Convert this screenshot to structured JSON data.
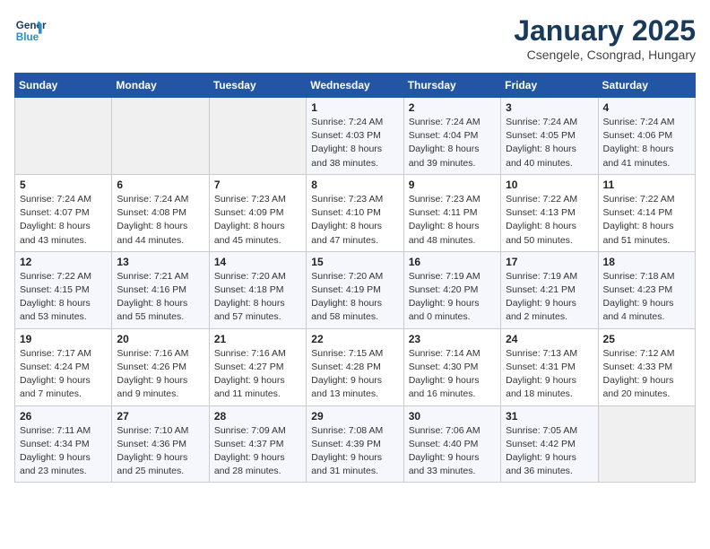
{
  "header": {
    "logo_line1": "General",
    "logo_line2": "Blue",
    "title": "January 2025",
    "subtitle": "Csengele, Csongrad, Hungary"
  },
  "weekdays": [
    "Sunday",
    "Monday",
    "Tuesday",
    "Wednesday",
    "Thursday",
    "Friday",
    "Saturday"
  ],
  "weeks": [
    [
      {
        "day": "",
        "info": ""
      },
      {
        "day": "",
        "info": ""
      },
      {
        "day": "",
        "info": ""
      },
      {
        "day": "1",
        "info": "Sunrise: 7:24 AM\nSunset: 4:03 PM\nDaylight: 8 hours\nand 38 minutes."
      },
      {
        "day": "2",
        "info": "Sunrise: 7:24 AM\nSunset: 4:04 PM\nDaylight: 8 hours\nand 39 minutes."
      },
      {
        "day": "3",
        "info": "Sunrise: 7:24 AM\nSunset: 4:05 PM\nDaylight: 8 hours\nand 40 minutes."
      },
      {
        "day": "4",
        "info": "Sunrise: 7:24 AM\nSunset: 4:06 PM\nDaylight: 8 hours\nand 41 minutes."
      }
    ],
    [
      {
        "day": "5",
        "info": "Sunrise: 7:24 AM\nSunset: 4:07 PM\nDaylight: 8 hours\nand 43 minutes."
      },
      {
        "day": "6",
        "info": "Sunrise: 7:24 AM\nSunset: 4:08 PM\nDaylight: 8 hours\nand 44 minutes."
      },
      {
        "day": "7",
        "info": "Sunrise: 7:23 AM\nSunset: 4:09 PM\nDaylight: 8 hours\nand 45 minutes."
      },
      {
        "day": "8",
        "info": "Sunrise: 7:23 AM\nSunset: 4:10 PM\nDaylight: 8 hours\nand 47 minutes."
      },
      {
        "day": "9",
        "info": "Sunrise: 7:23 AM\nSunset: 4:11 PM\nDaylight: 8 hours\nand 48 minutes."
      },
      {
        "day": "10",
        "info": "Sunrise: 7:22 AM\nSunset: 4:13 PM\nDaylight: 8 hours\nand 50 minutes."
      },
      {
        "day": "11",
        "info": "Sunrise: 7:22 AM\nSunset: 4:14 PM\nDaylight: 8 hours\nand 51 minutes."
      }
    ],
    [
      {
        "day": "12",
        "info": "Sunrise: 7:22 AM\nSunset: 4:15 PM\nDaylight: 8 hours\nand 53 minutes."
      },
      {
        "day": "13",
        "info": "Sunrise: 7:21 AM\nSunset: 4:16 PM\nDaylight: 8 hours\nand 55 minutes."
      },
      {
        "day": "14",
        "info": "Sunrise: 7:20 AM\nSunset: 4:18 PM\nDaylight: 8 hours\nand 57 minutes."
      },
      {
        "day": "15",
        "info": "Sunrise: 7:20 AM\nSunset: 4:19 PM\nDaylight: 8 hours\nand 58 minutes."
      },
      {
        "day": "16",
        "info": "Sunrise: 7:19 AM\nSunset: 4:20 PM\nDaylight: 9 hours\nand 0 minutes."
      },
      {
        "day": "17",
        "info": "Sunrise: 7:19 AM\nSunset: 4:21 PM\nDaylight: 9 hours\nand 2 minutes."
      },
      {
        "day": "18",
        "info": "Sunrise: 7:18 AM\nSunset: 4:23 PM\nDaylight: 9 hours\nand 4 minutes."
      }
    ],
    [
      {
        "day": "19",
        "info": "Sunrise: 7:17 AM\nSunset: 4:24 PM\nDaylight: 9 hours\nand 7 minutes."
      },
      {
        "day": "20",
        "info": "Sunrise: 7:16 AM\nSunset: 4:26 PM\nDaylight: 9 hours\nand 9 minutes."
      },
      {
        "day": "21",
        "info": "Sunrise: 7:16 AM\nSunset: 4:27 PM\nDaylight: 9 hours\nand 11 minutes."
      },
      {
        "day": "22",
        "info": "Sunrise: 7:15 AM\nSunset: 4:28 PM\nDaylight: 9 hours\nand 13 minutes."
      },
      {
        "day": "23",
        "info": "Sunrise: 7:14 AM\nSunset: 4:30 PM\nDaylight: 9 hours\nand 16 minutes."
      },
      {
        "day": "24",
        "info": "Sunrise: 7:13 AM\nSunset: 4:31 PM\nDaylight: 9 hours\nand 18 minutes."
      },
      {
        "day": "25",
        "info": "Sunrise: 7:12 AM\nSunset: 4:33 PM\nDaylight: 9 hours\nand 20 minutes."
      }
    ],
    [
      {
        "day": "26",
        "info": "Sunrise: 7:11 AM\nSunset: 4:34 PM\nDaylight: 9 hours\nand 23 minutes."
      },
      {
        "day": "27",
        "info": "Sunrise: 7:10 AM\nSunset: 4:36 PM\nDaylight: 9 hours\nand 25 minutes."
      },
      {
        "day": "28",
        "info": "Sunrise: 7:09 AM\nSunset: 4:37 PM\nDaylight: 9 hours\nand 28 minutes."
      },
      {
        "day": "29",
        "info": "Sunrise: 7:08 AM\nSunset: 4:39 PM\nDaylight: 9 hours\nand 31 minutes."
      },
      {
        "day": "30",
        "info": "Sunrise: 7:06 AM\nSunset: 4:40 PM\nDaylight: 9 hours\nand 33 minutes."
      },
      {
        "day": "31",
        "info": "Sunrise: 7:05 AM\nSunset: 4:42 PM\nDaylight: 9 hours\nand 36 minutes."
      },
      {
        "day": "",
        "info": ""
      }
    ]
  ]
}
